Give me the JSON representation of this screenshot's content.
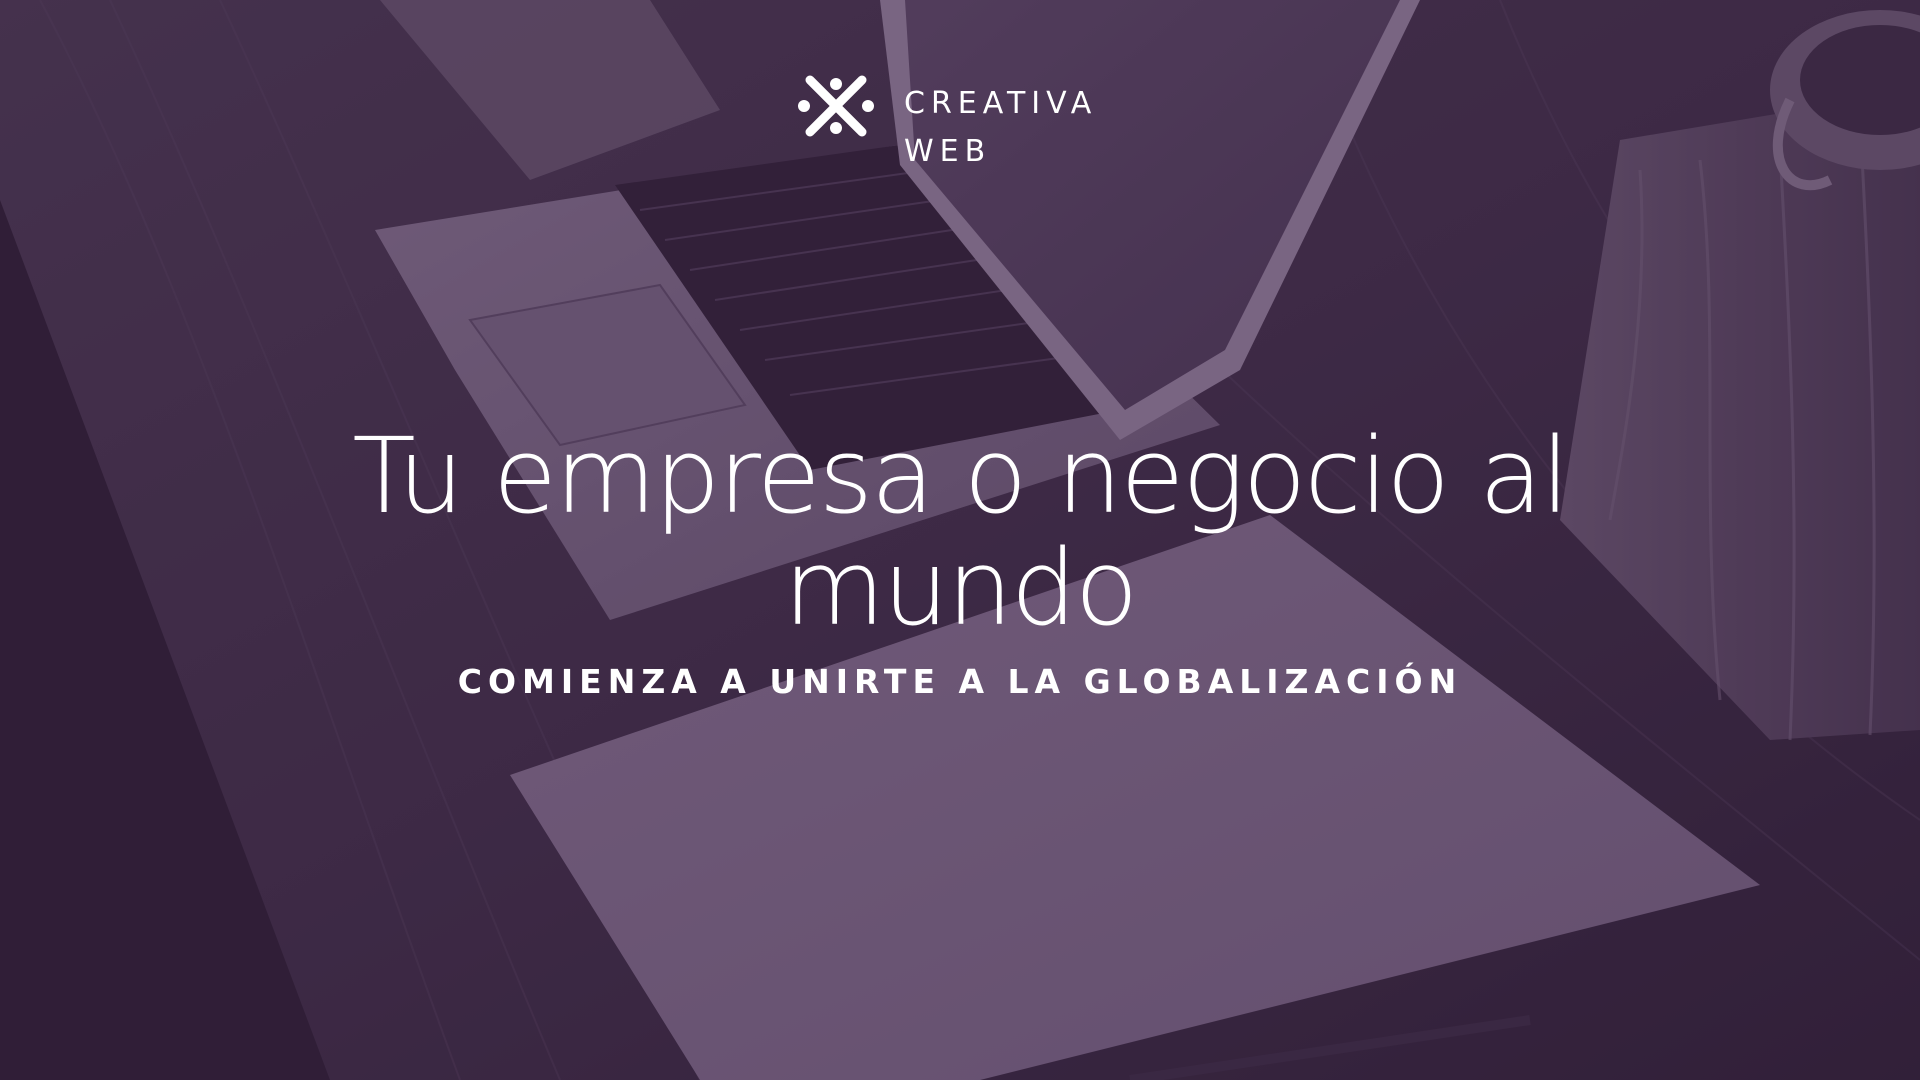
{
  "brand": {
    "line1": "CREATIVA",
    "line2": "WEB",
    "logo_icon": "x-cross-dots-icon"
  },
  "hero": {
    "title": "Tu empresa o negocio al mundo",
    "subtitle": "COMIENZA A UNIRTE A LA GLOBALIZACIÓN",
    "background_description_icon": "laptop-desk-photo",
    "overlay_color": "#3c1c46"
  }
}
